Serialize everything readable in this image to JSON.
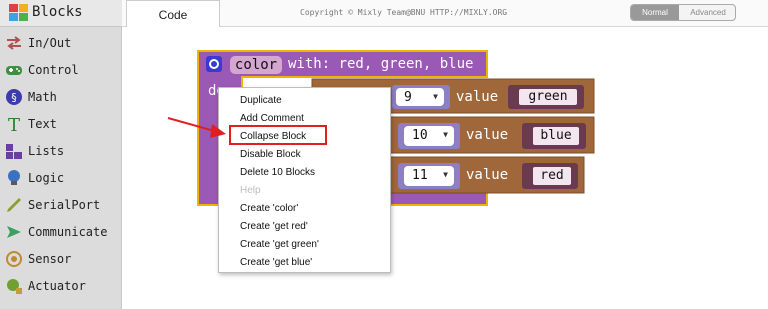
{
  "sidebar": {
    "header_title": "Blocks",
    "items": [
      {
        "label": "In/Out",
        "color": "#b05050"
      },
      {
        "label": "Control",
        "color": "#3f8f3f"
      },
      {
        "label": "Math",
        "color": "#3c3cb0"
      },
      {
        "label": "Text",
        "color": "#2e7d32"
      },
      {
        "label": "Lists",
        "color": "#6a3fa0"
      },
      {
        "label": "Logic",
        "color": "#3a72c0"
      },
      {
        "label": "SerialPort",
        "color": "#8aa030"
      },
      {
        "label": "Communicate",
        "color": "#3aa060"
      },
      {
        "label": "Sensor",
        "color": "#c08a30"
      },
      {
        "label": "Actuator",
        "color": "#70a030"
      }
    ]
  },
  "topbar": {
    "tab_code": "Code",
    "copyright": "Copyright © Mixly Team@BNU HTTP://MIXLY.ORG",
    "mode_normal": "Normal",
    "mode_advanced": "Advanced"
  },
  "block": {
    "proc_name": "color",
    "proc_params": "with: red, green, blue",
    "do_label": "do",
    "rows": [
      {
        "pin": "9",
        "value_label": "value",
        "string": "green"
      },
      {
        "pin": "10",
        "value_label": "value",
        "string": "blue"
      },
      {
        "pin": "11",
        "value_label": "value",
        "string": "red"
      }
    ],
    "colors": {
      "procedure": "#9b59b6",
      "procedure_border": "#f0b400",
      "output": "#a0673a"
    }
  },
  "context_menu": {
    "items": [
      {
        "label": "Duplicate",
        "enabled": true
      },
      {
        "label": "Add Comment",
        "enabled": true
      },
      {
        "label": "Collapse Block",
        "enabled": true,
        "highlighted": true
      },
      {
        "label": "Disable Block",
        "enabled": true
      },
      {
        "label": "Delete 10 Blocks",
        "enabled": true
      },
      {
        "label": "Help",
        "enabled": false
      },
      {
        "label": "Create 'color'",
        "enabled": true
      },
      {
        "label": "Create 'get red'",
        "enabled": true
      },
      {
        "label": "Create 'get green'",
        "enabled": true
      },
      {
        "label": "Create 'get blue'",
        "enabled": true
      }
    ],
    "highlight_color": "#e02020"
  }
}
